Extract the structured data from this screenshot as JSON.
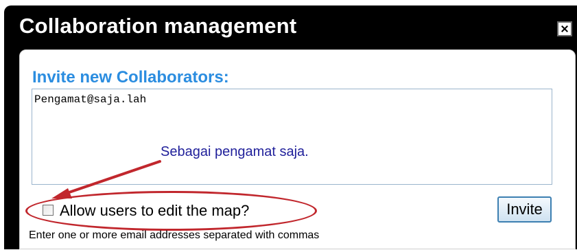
{
  "dialog": {
    "title": "Collaboration management",
    "close_icon": "close-icon"
  },
  "invite": {
    "heading": "Invite new Collaborators:",
    "emails_value": "Pengamat@saja.lah",
    "annotation": "Sebagai pengamat saja.",
    "allow_edit_label": "Allow users to edit the map?",
    "allow_edit_checked": false,
    "invite_button": "Invite",
    "helper_text": "Enter one or more email addresses separated with commas"
  },
  "colors": {
    "heading": "#2b8de0",
    "annotation": "#1f1f9a",
    "highlight": "#c1272d"
  }
}
